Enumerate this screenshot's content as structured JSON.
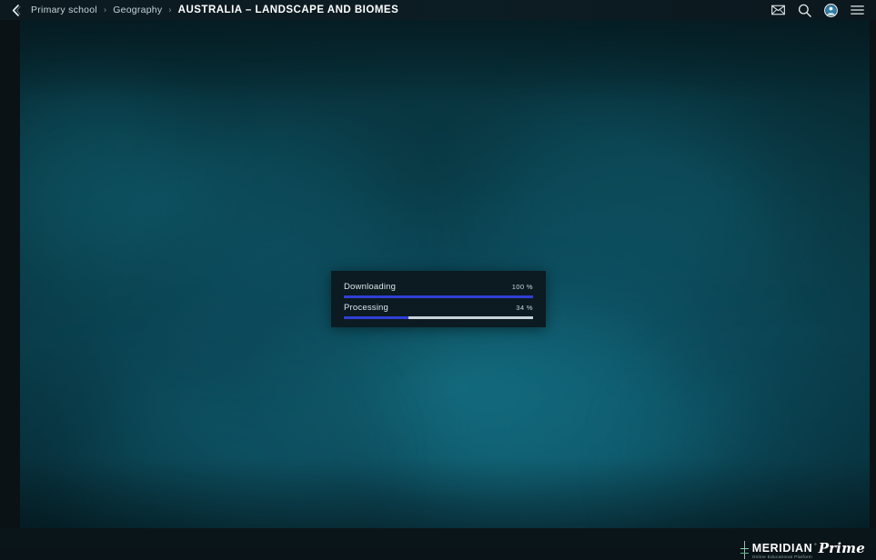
{
  "topbar": {
    "back_icon": "chevron-left-icon",
    "breadcrumb": {
      "items": [
        {
          "label": "Primary school",
          "current": false
        },
        {
          "label": "Geography",
          "current": false
        }
      ],
      "separator": "›",
      "current": "AUSTRALIA – LANDSCAPE AND BIOMES"
    },
    "actions": [
      {
        "name": "mail-icon",
        "title": "Messages"
      },
      {
        "name": "search-icon",
        "title": "Search"
      },
      {
        "name": "avatar-icon",
        "title": "Account"
      },
      {
        "name": "hamburger-menu-icon",
        "title": "Menu"
      }
    ]
  },
  "dialog": {
    "rows": [
      {
        "label": "Downloading",
        "percent_text": "100 %",
        "percent": 100
      },
      {
        "label": "Processing",
        "percent_text": "34 %",
        "percent": 34
      }
    ]
  },
  "footer": {
    "brand_name": "MERIDIAN",
    "brand_sup": "°",
    "brand_prime": "Prime",
    "tagline": "Online educational platform"
  },
  "colors": {
    "accent_blue": "#2f3fd6",
    "track_light": "#c7d3d7",
    "topbar_bg": "#0c1a20",
    "dialog_bg": "#0c1a21",
    "stage_teal": "#0b4352"
  }
}
